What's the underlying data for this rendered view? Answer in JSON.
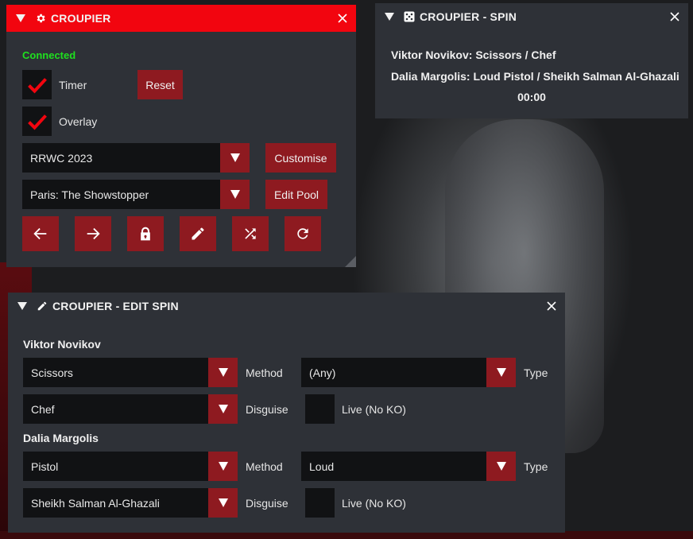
{
  "croupier": {
    "title": "CROUPIER",
    "status": "Connected",
    "timer_label": "Timer",
    "overlay_label": "Overlay",
    "reset_label": "Reset",
    "roulette_select": "RRWC 2023",
    "customise_label": "Customise",
    "mission_select": "Paris: The Showstopper",
    "edit_pool_label": "Edit Pool",
    "accent": "#f2050f",
    "status_color": "#1fe01f",
    "icon_buttons": [
      "arrow-left-icon",
      "arrow-right-icon",
      "lock-icon",
      "pencil-icon",
      "shuffle-icon",
      "refresh-icon"
    ]
  },
  "spin": {
    "title": "CROUPIER - SPIN",
    "line1": "Viktor Novikov: Scissors / Chef",
    "line2": "Dalia Margolis: Loud Pistol / Sheikh Salman Al-Ghazali",
    "timer": "00:00"
  },
  "edit": {
    "title": "CROUPIER - EDIT SPIN",
    "targets": [
      {
        "name": "Viktor Novikov",
        "method": "Scissors",
        "method_label": "Method",
        "type": "(Any)",
        "type_label": "Type",
        "disguise": "Chef",
        "disguise_label": "Disguise",
        "live_label": "Live (No KO)"
      },
      {
        "name": "Dalia Margolis",
        "method": "Pistol",
        "method_label": "Method",
        "type": "Loud",
        "type_label": "Type",
        "disguise": "Sheikh Salman Al-Ghazali",
        "disguise_label": "Disguise",
        "live_label": "Live (No KO)"
      }
    ]
  }
}
